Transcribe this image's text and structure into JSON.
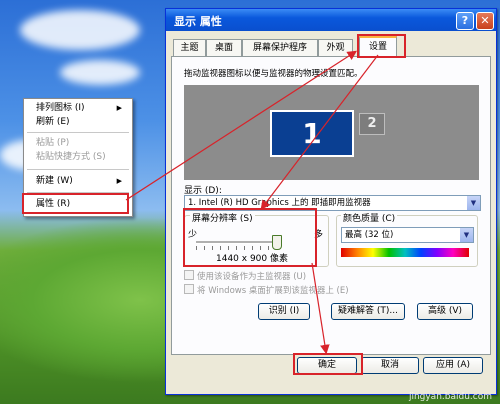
{
  "context_menu": {
    "items": [
      {
        "label": "排列图标 (I)",
        "submenu": true,
        "disabled": false
      },
      {
        "label": "刷新 (E)",
        "submenu": false,
        "disabled": false
      },
      {
        "label": "粘贴 (P)",
        "submenu": false,
        "disabled": true
      },
      {
        "label": "粘贴快捷方式 (S)",
        "submenu": false,
        "disabled": true
      },
      {
        "label": "新建 (W)",
        "submenu": true,
        "disabled": false
      },
      {
        "label": "属性 (R)",
        "submenu": false,
        "disabled": false
      }
    ]
  },
  "dialog": {
    "title": "显示 属性",
    "help_glyph": "?",
    "close_glyph": "✕",
    "tabs": [
      "主题",
      "桌面",
      "屏幕保护程序",
      "外观",
      "设置"
    ],
    "active_tab": "设置",
    "instruction": "拖动监视器图标以便与监视器的物理设置匹配。",
    "monitor1": "1",
    "monitor2": "2",
    "display_label": "显示 (D):",
    "display_value": "1. Intel (R) HD Graphics 上的 即插即用监视器",
    "resolution_label": "屏幕分辨率 (S)",
    "resolution_less": "少",
    "resolution_more": "多",
    "resolution_value": "1440 x 900 像素",
    "resolution_slider_fraction": 1.0,
    "color_label": "颜色质量 (C)",
    "color_value": "最高 (32 位)",
    "checkbox_primary": "使用该设备作为主监视器 (U)",
    "checkbox_extend": "将 Windows 桌面扩展到该监视器上 (E)",
    "buttons": {
      "identify": "识别 (I)",
      "troubleshoot": "疑难解答 (T)...",
      "advanced": "高级 (V)"
    },
    "footer": {
      "ok": "确定",
      "cancel": "取消",
      "apply": "应用 (A)"
    }
  },
  "watermark": "jingyan.baidu.com",
  "colors": {
    "title_bar": "#0a58dc",
    "highlight": "#d8232a",
    "dialog_bg": "#ece9d8"
  }
}
